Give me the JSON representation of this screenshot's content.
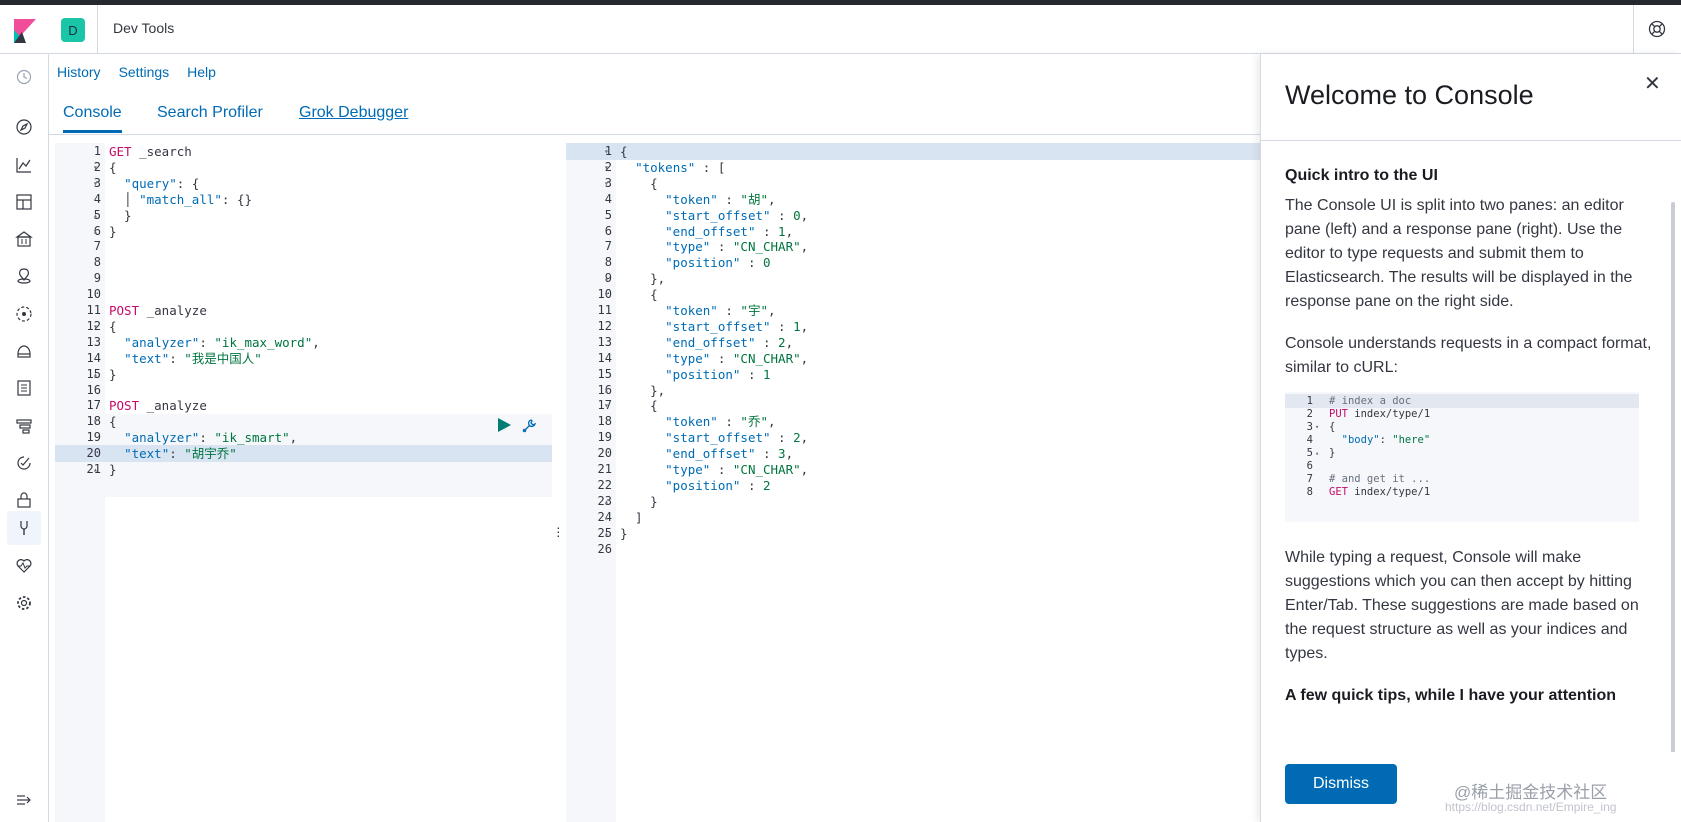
{
  "header": {
    "space_initial": "D",
    "title": "Dev Tools"
  },
  "toplinks": [
    "History",
    "Settings",
    "Help"
  ],
  "tabs": [
    "Console",
    "Search Profiler",
    "Grok Debugger"
  ],
  "editor_left": [
    {
      "n": "1",
      "f": "",
      "parts": [
        [
          "m",
          "GET"
        ],
        [
          "",
          " _search"
        ]
      ]
    },
    {
      "n": "2",
      "f": "▾",
      "parts": [
        [
          "",
          "{"
        ]
      ]
    },
    {
      "n": "3",
      "f": "▾",
      "parts": [
        [
          "",
          "  "
        ],
        [
          "k",
          "\"query\""
        ],
        [
          "",
          ": {"
        ]
      ]
    },
    {
      "n": "4",
      "f": "",
      "parts": [
        [
          "",
          "  │ "
        ],
        [
          "k",
          "\"match_all\""
        ],
        [
          "",
          ": {}"
        ]
      ]
    },
    {
      "n": "5",
      "f": "▴",
      "parts": [
        [
          "",
          "  }"
        ]
      ]
    },
    {
      "n": "6",
      "f": "▴",
      "parts": [
        [
          "",
          "}"
        ]
      ]
    },
    {
      "n": "7",
      "f": "",
      "parts": []
    },
    {
      "n": "8",
      "f": "",
      "parts": []
    },
    {
      "n": "9",
      "f": "",
      "parts": []
    },
    {
      "n": "10",
      "f": "",
      "parts": []
    },
    {
      "n": "11",
      "f": "",
      "parts": [
        [
          "m",
          "POST"
        ],
        [
          "",
          " _analyze"
        ]
      ]
    },
    {
      "n": "12",
      "f": "▾",
      "parts": [
        [
          "",
          "{"
        ]
      ]
    },
    {
      "n": "13",
      "f": "",
      "parts": [
        [
          "",
          "  "
        ],
        [
          "k",
          "\"analyzer\""
        ],
        [
          "",
          ": "
        ],
        [
          "s",
          "\"ik_max_word\""
        ],
        [
          "",
          ","
        ]
      ]
    },
    {
      "n": "14",
      "f": "",
      "parts": [
        [
          "",
          "  "
        ],
        [
          "k",
          "\"text\""
        ],
        [
          "",
          ": "
        ],
        [
          "s",
          "\"我是中国人\""
        ]
      ]
    },
    {
      "n": "15",
      "f": "▴",
      "parts": [
        [
          "",
          "}"
        ]
      ]
    },
    {
      "n": "16",
      "f": "",
      "parts": []
    },
    {
      "n": "17",
      "f": "",
      "parts": [
        [
          "m",
          "POST"
        ],
        [
          "",
          " _analyze"
        ]
      ]
    },
    {
      "n": "18",
      "f": "▾",
      "parts": [
        [
          "",
          "{"
        ]
      ]
    },
    {
      "n": "19",
      "f": "",
      "parts": [
        [
          "",
          "  "
        ],
        [
          "k",
          "\"analyzer\""
        ],
        [
          "",
          ": "
        ],
        [
          "s",
          "\"ik_smart\""
        ],
        [
          "",
          ","
        ]
      ]
    },
    {
      "n": "20",
      "f": "",
      "parts": [
        [
          "",
          "  "
        ],
        [
          "k",
          "\"text\""
        ],
        [
          "",
          ": "
        ],
        [
          "s",
          "\"胡宇乔\""
        ]
      ]
    },
    {
      "n": "21",
      "f": "▴",
      "parts": [
        [
          "",
          "}"
        ]
      ]
    }
  ],
  "editor_right": [
    {
      "n": "1",
      "f": "▾",
      "parts": [
        [
          "",
          "{"
        ]
      ]
    },
    {
      "n": "2",
      "f": "▾",
      "parts": [
        [
          "",
          "  "
        ],
        [
          "k",
          "\"tokens\""
        ],
        [
          "",
          " : ["
        ]
      ]
    },
    {
      "n": "3",
      "f": "▾",
      "parts": [
        [
          "",
          "    {"
        ]
      ]
    },
    {
      "n": "4",
      "f": "",
      "parts": [
        [
          "",
          "      "
        ],
        [
          "k",
          "\"token\""
        ],
        [
          "",
          " : "
        ],
        [
          "s",
          "\"胡\""
        ],
        [
          "",
          ","
        ]
      ]
    },
    {
      "n": "5",
      "f": "",
      "parts": [
        [
          "",
          "      "
        ],
        [
          "k",
          "\"start_offset\""
        ],
        [
          "",
          " : "
        ],
        [
          "s",
          "0"
        ],
        [
          "",
          ","
        ]
      ]
    },
    {
      "n": "6",
      "f": "",
      "parts": [
        [
          "",
          "      "
        ],
        [
          "k",
          "\"end_offset\""
        ],
        [
          "",
          " : "
        ],
        [
          "s",
          "1"
        ],
        [
          "",
          ","
        ]
      ]
    },
    {
      "n": "7",
      "f": "",
      "parts": [
        [
          "",
          "      "
        ],
        [
          "k",
          "\"type\""
        ],
        [
          "",
          " : "
        ],
        [
          "s",
          "\"CN_CHAR\""
        ],
        [
          "",
          ","
        ]
      ]
    },
    {
      "n": "8",
      "f": "",
      "parts": [
        [
          "",
          "      "
        ],
        [
          "k",
          "\"position\""
        ],
        [
          "",
          " : "
        ],
        [
          "s",
          "0"
        ]
      ]
    },
    {
      "n": "9",
      "f": "▴",
      "parts": [
        [
          "",
          "    },"
        ]
      ]
    },
    {
      "n": "10",
      "f": "▾",
      "parts": [
        [
          "",
          "    {"
        ]
      ]
    },
    {
      "n": "11",
      "f": "",
      "parts": [
        [
          "",
          "      "
        ],
        [
          "k",
          "\"token\""
        ],
        [
          "",
          " : "
        ],
        [
          "s",
          "\"宇\""
        ],
        [
          "",
          ","
        ]
      ]
    },
    {
      "n": "12",
      "f": "",
      "parts": [
        [
          "",
          "      "
        ],
        [
          "k",
          "\"start_offset\""
        ],
        [
          "",
          " : "
        ],
        [
          "s",
          "1"
        ],
        [
          "",
          ","
        ]
      ]
    },
    {
      "n": "13",
      "f": "",
      "parts": [
        [
          "",
          "      "
        ],
        [
          "k",
          "\"end_offset\""
        ],
        [
          "",
          " : "
        ],
        [
          "s",
          "2"
        ],
        [
          "",
          ","
        ]
      ]
    },
    {
      "n": "14",
      "f": "",
      "parts": [
        [
          "",
          "      "
        ],
        [
          "k",
          "\"type\""
        ],
        [
          "",
          " : "
        ],
        [
          "s",
          "\"CN_CHAR\""
        ],
        [
          "",
          ","
        ]
      ]
    },
    {
      "n": "15",
      "f": "",
      "parts": [
        [
          "",
          "      "
        ],
        [
          "k",
          "\"position\""
        ],
        [
          "",
          " : "
        ],
        [
          "s",
          "1"
        ]
      ]
    },
    {
      "n": "16",
      "f": "▴",
      "parts": [
        [
          "",
          "    },"
        ]
      ]
    },
    {
      "n": "17",
      "f": "▾",
      "parts": [
        [
          "",
          "    {"
        ]
      ]
    },
    {
      "n": "18",
      "f": "",
      "parts": [
        [
          "",
          "      "
        ],
        [
          "k",
          "\"token\""
        ],
        [
          "",
          " : "
        ],
        [
          "s",
          "\"乔\""
        ],
        [
          "",
          ","
        ]
      ]
    },
    {
      "n": "19",
      "f": "",
      "parts": [
        [
          "",
          "      "
        ],
        [
          "k",
          "\"start_offset\""
        ],
        [
          "",
          " : "
        ],
        [
          "s",
          "2"
        ],
        [
          "",
          ","
        ]
      ]
    },
    {
      "n": "20",
      "f": "",
      "parts": [
        [
          "",
          "      "
        ],
        [
          "k",
          "\"end_offset\""
        ],
        [
          "",
          " : "
        ],
        [
          "s",
          "3"
        ],
        [
          "",
          ","
        ]
      ]
    },
    {
      "n": "21",
      "f": "",
      "parts": [
        [
          "",
          "      "
        ],
        [
          "k",
          "\"type\""
        ],
        [
          "",
          " : "
        ],
        [
          "s",
          "\"CN_CHAR\""
        ],
        [
          "",
          ","
        ]
      ]
    },
    {
      "n": "22",
      "f": "",
      "parts": [
        [
          "",
          "      "
        ],
        [
          "k",
          "\"position\""
        ],
        [
          "",
          " : "
        ],
        [
          "s",
          "2"
        ]
      ]
    },
    {
      "n": "23",
      "f": "▴",
      "parts": [
        [
          "",
          "    }"
        ]
      ]
    },
    {
      "n": "24",
      "f": "▴",
      "parts": [
        [
          "",
          "  ]"
        ]
      ]
    },
    {
      "n": "25",
      "f": "▴",
      "parts": [
        [
          "",
          "}"
        ]
      ]
    },
    {
      "n": "26",
      "f": "",
      "parts": []
    }
  ],
  "flyout": {
    "title": "Welcome to Console",
    "section1_title": "Quick intro to the UI",
    "para1": "The Console UI is split into two panes: an editor pane (left) and a response pane (right). Use the editor to type requests and submit them to Elasticsearch. The results will be displayed in the response pane on the right side.",
    "para2": "Console understands requests in a compact format, similar to cURL:",
    "example": [
      {
        "n": "1",
        "f": "",
        "parts": [
          [
            "c",
            "# index a doc"
          ]
        ]
      },
      {
        "n": "2",
        "f": "",
        "parts": [
          [
            "m",
            "PUT"
          ],
          [
            "",
            " index/type/1"
          ]
        ]
      },
      {
        "n": "3",
        "f": "▾",
        "parts": [
          [
            "",
            "{"
          ]
        ]
      },
      {
        "n": "4",
        "f": "",
        "parts": [
          [
            "",
            "  "
          ],
          [
            "k",
            "\"body\""
          ],
          [
            "",
            ": "
          ],
          [
            "s",
            "\"here\""
          ]
        ]
      },
      {
        "n": "5",
        "f": "▴",
        "parts": [
          [
            "",
            "}"
          ]
        ]
      },
      {
        "n": "6",
        "f": "",
        "parts": []
      },
      {
        "n": "7",
        "f": "",
        "parts": [
          [
            "c",
            "# and get it ..."
          ]
        ]
      },
      {
        "n": "8",
        "f": "",
        "parts": [
          [
            "m",
            "GET"
          ],
          [
            "",
            " index/type/1"
          ]
        ]
      }
    ],
    "para3": "While typing a request, Console will make suggestions which you can then accept by hitting Enter/Tab. These suggestions are made based on the request structure as well as your indices and types.",
    "section2_title": "A few quick tips, while I have your attention",
    "dismiss_label": "Dismiss"
  },
  "watermark": "@稀土掘金技术社区",
  "watermark_url": "https://blog.csdn.net/Empire_ing"
}
